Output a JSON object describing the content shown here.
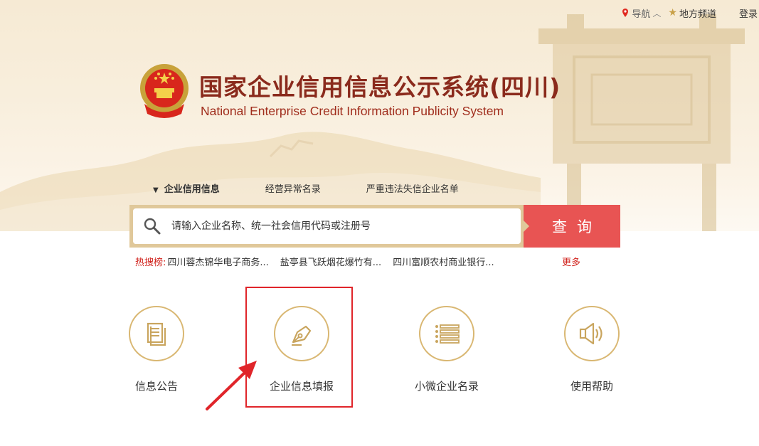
{
  "topbar": {
    "nav_label": "导航",
    "region_label": "地方频道",
    "login_label": "登录"
  },
  "header": {
    "title_cn": "国家企业信用信息公示系统(四川)",
    "title_en": "National Enterprise Credit Information Publicity System"
  },
  "search": {
    "tabs": [
      {
        "label": "企业信用信息",
        "active": true
      },
      {
        "label": "经营异常名录",
        "active": false
      },
      {
        "label": "严重违法失信企业名单",
        "active": false
      }
    ],
    "placeholder": "请输入企业名称、统一社会信用代码或注册号",
    "button_label": "查询"
  },
  "hot_search": {
    "label": "热搜榜:",
    "items": [
      "四川蓉杰锦华电子商务...",
      "盐亭县飞跃烟花爆竹有...",
      "四川富顺农村商业银行..."
    ],
    "more_label": "更多"
  },
  "functions": [
    {
      "label": "信息公告",
      "icon": "document-icon"
    },
    {
      "label": "企业信息填报",
      "icon": "pen-nib-icon"
    },
    {
      "label": "小微企业名录",
      "icon": "list-icon"
    },
    {
      "label": "使用帮助",
      "icon": "speaker-icon"
    }
  ],
  "colors": {
    "accent_red": "#e85453",
    "gold": "#d9b772",
    "title_red": "#8a2a1c",
    "highlight_red": "#e0252a"
  }
}
